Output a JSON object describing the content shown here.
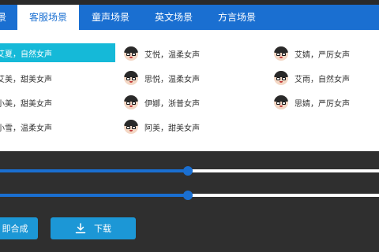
{
  "tabs": [
    {
      "label": "景"
    },
    {
      "label": "客服场景"
    },
    {
      "label": "童声场景"
    },
    {
      "label": "英文场景"
    },
    {
      "label": "方言场景"
    }
  ],
  "active_tab": "客服场景",
  "voices": {
    "col1": [
      "艾夏，自然女声",
      "艾美，甜美女声",
      "小美，甜美女声",
      "小雪，温柔女声"
    ],
    "col2": [
      "艾悦，温柔女声",
      "思悦，温柔女声",
      "伊娜，浙普女声",
      "阿美，甜美女声"
    ],
    "col3": [
      "艾婧，严厉女声",
      "艾雨，自然女声",
      "思婧，严厉女声"
    ]
  },
  "selected_voice": "艾夏，自然女声",
  "sliders": [
    {
      "name": "slider-1",
      "level_percent": 49.6
    },
    {
      "name": "slider-2",
      "level_percent": 49.6
    }
  ],
  "buttons": {
    "synthesize_label": "即合成",
    "download_label": "下载"
  },
  "colors": {
    "accent": "#1a6fd1",
    "selected": "#15b9d8",
    "button": "#1c97d6",
    "background": "#2f2f2f"
  },
  "icons": {
    "avatar": "cartoon-avatar-icon",
    "download": "download-icon"
  }
}
